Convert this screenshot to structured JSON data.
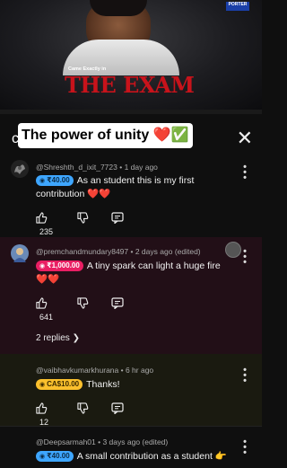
{
  "video": {
    "brand_badge": "PORTER",
    "subtitle_small": "Came Exactly in",
    "title_big": "THE EXAM"
  },
  "header": {
    "caption": "The power of unity ❤️✅",
    "close_glyph": "✕"
  },
  "comments": [
    {
      "author": "@Shreshth_d_ixit_7723",
      "time": "1 day ago",
      "edited": "",
      "badge": "₹40.00",
      "badge_color": "#3ea6ff",
      "text_lead": "As an student this is my first",
      "text_rest": "contribution ❤️❤️",
      "likes": "235",
      "bg": "#0f0f0f"
    },
    {
      "author": "@premchandmundary8497",
      "time": "2 days ago",
      "edited": "(edited)",
      "badge": "₹1,000.00",
      "badge_color": "#e91e63",
      "text_lead": "A tiny spark can light a huge fire",
      "text_rest": "❤️❤️",
      "likes": "641",
      "replies": "2 replies",
      "bg": "#220f17"
    },
    {
      "author": "@vaibhavkumarkhurana",
      "time": "6 hr ago",
      "edited": "",
      "badge": "CA$10.00",
      "badge_color": "#fbc02d",
      "text_lead": "Thanks!",
      "text_rest": "",
      "likes": "12",
      "bg": "#1a1a10"
    },
    {
      "author": "@Deepsarmah01",
      "time": "3 days ago",
      "edited": "(edited)",
      "badge": "₹40.00",
      "badge_color": "#3ea6ff",
      "text_lead": "A small contribution as a student 👉",
      "text_rest": "",
      "bg": "#0f0f0f"
    }
  ]
}
